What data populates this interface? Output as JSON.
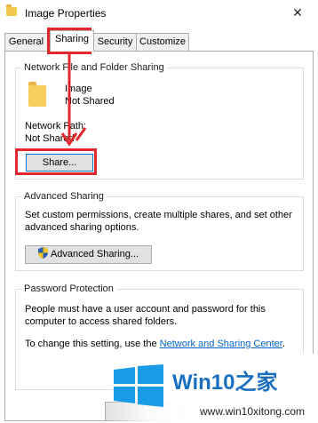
{
  "window": {
    "title": "Image Properties",
    "close_glyph": "✕"
  },
  "tabs": [
    {
      "label": "General"
    },
    {
      "label": "Sharing"
    },
    {
      "label": "Security"
    },
    {
      "label": "Customize"
    }
  ],
  "network_sharing": {
    "group_title": "Network File and Folder Sharing",
    "folder_name": "Image",
    "folder_state": "Not Shared",
    "path_label": "Network Path:",
    "path_value": "Not Shared",
    "share_button": "Share..."
  },
  "advanced_sharing": {
    "group_title": "Advanced Sharing",
    "description": "Set custom permissions, create multiple shares, and set other advanced sharing options.",
    "line1": "Set custom permissions, create multiple shares, and set other",
    "line2": "advanced sharing options.",
    "button": "Advanced Sharing..."
  },
  "password_protection": {
    "group_title": "Password Protection",
    "line1": "People must have a user account and password for this",
    "line2": "computer to access shared folders.",
    "change_prefix": "To change this setting, use the ",
    "link": "Network and Sharing Center",
    "change_suffix": "."
  },
  "watermark": {
    "brand": "Win10之家",
    "url": "www.win10xitong.com"
  },
  "colors": {
    "accent": "#0078d7",
    "highlight_red": "#e0282e",
    "folder": "#f7cd5c",
    "link": "#0066cc"
  }
}
